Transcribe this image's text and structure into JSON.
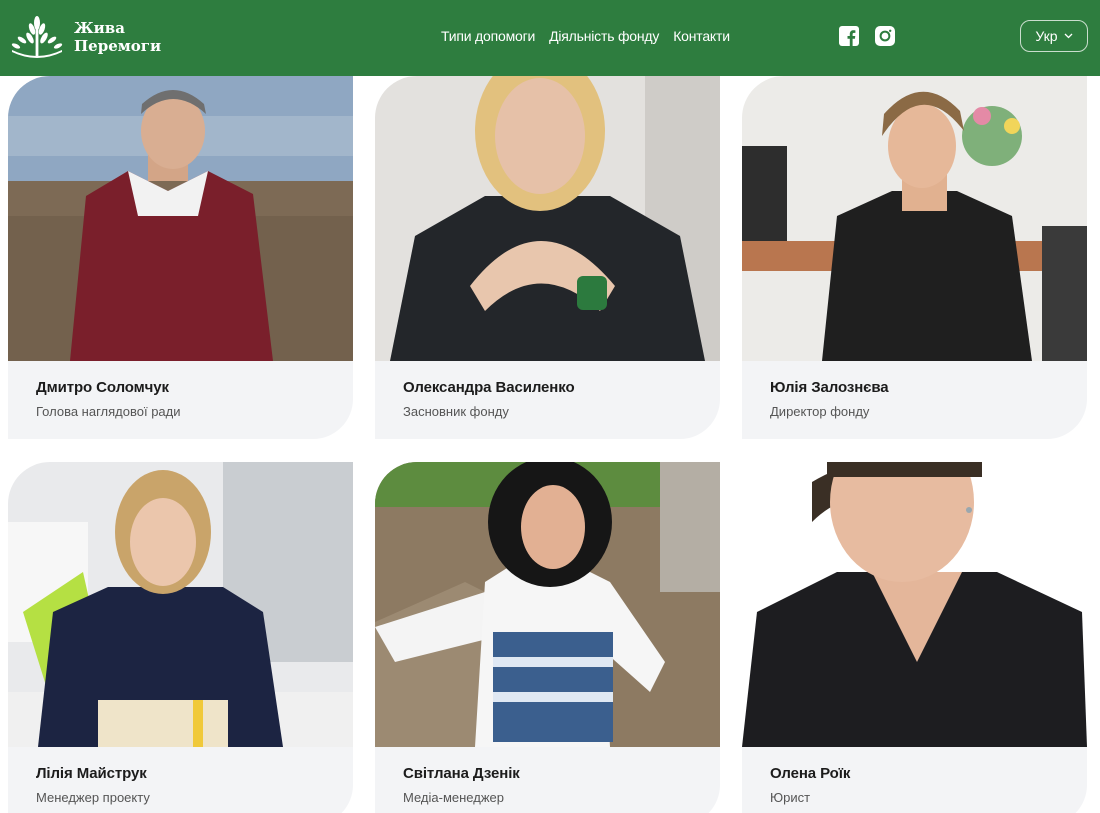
{
  "brand": {
    "line1": "Жива",
    "line2": "Перемоги",
    "color": "#2e7d3f"
  },
  "nav": {
    "items": [
      "Типи допомоги",
      "Діяльність фонду",
      "Контакти"
    ]
  },
  "social": {
    "icons": [
      "facebook-icon",
      "instagram-icon"
    ]
  },
  "language": {
    "selected": "Укр"
  },
  "team": [
    {
      "name": "Дмитро Соломчук",
      "role": "Голова наглядової ради"
    },
    {
      "name": "Олександра Василенко",
      "role": "Засновник фонду"
    },
    {
      "name": "Юлія Залознєва",
      "role": "Директор фонду"
    },
    {
      "name": "Лілія Майструк",
      "role": "Менеджер проекту"
    },
    {
      "name": "Світлана Дзенік",
      "role": "Медіа-менеджер"
    },
    {
      "name": "Олена Роїк",
      "role": "Юрист"
    }
  ]
}
